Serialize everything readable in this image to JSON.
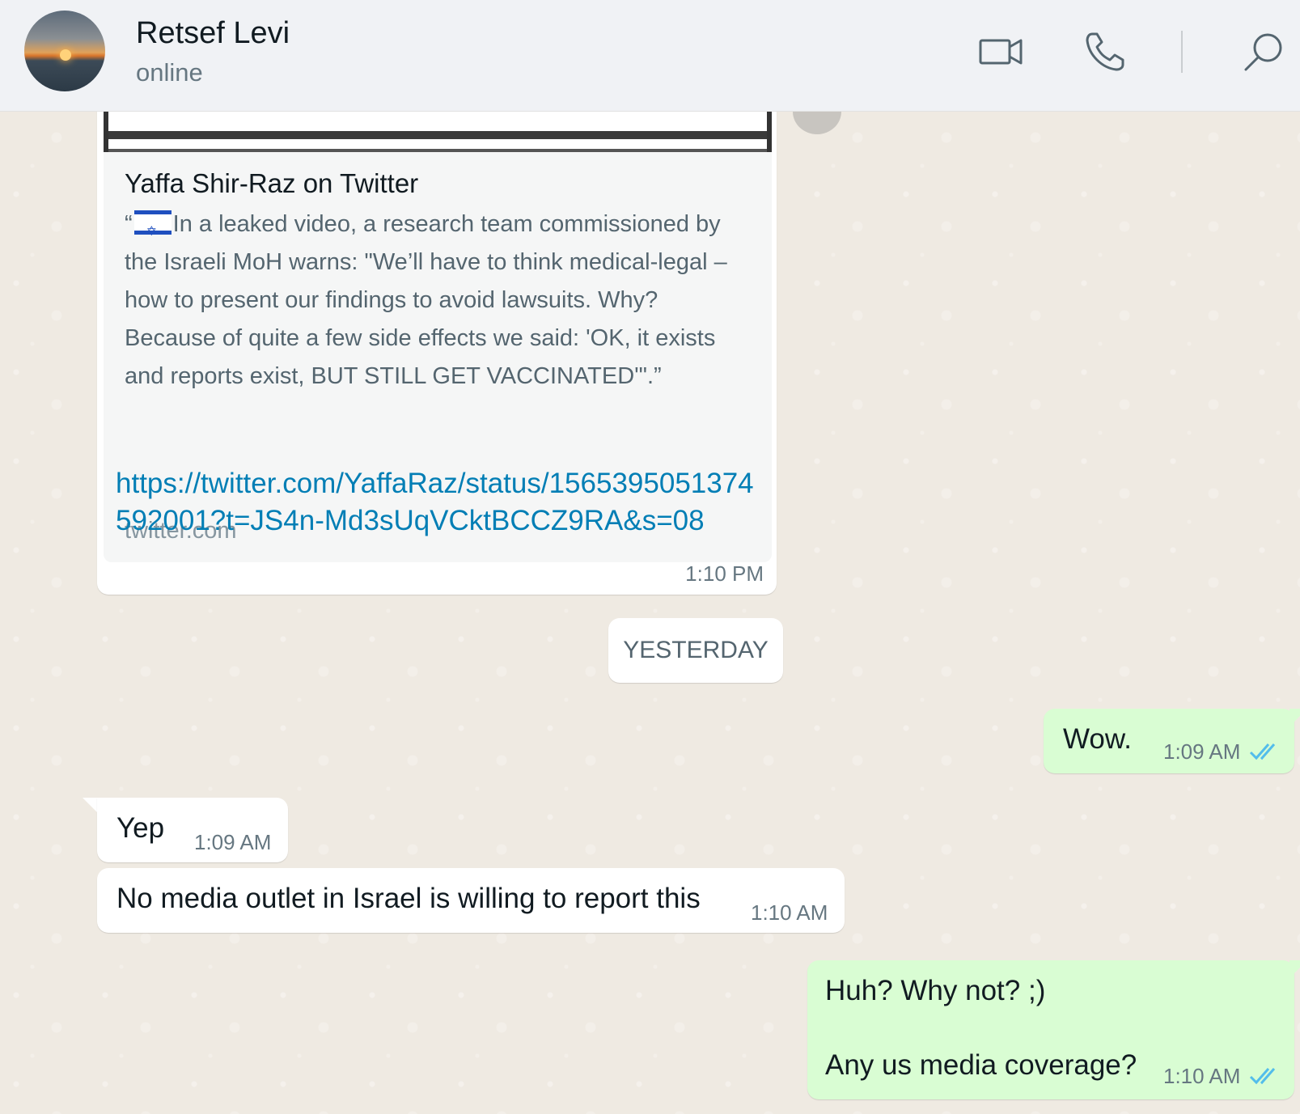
{
  "header": {
    "contact_name": "Retsef Levi",
    "status": "online",
    "icons": [
      "video-call-icon",
      "voice-call-icon",
      "search-icon"
    ]
  },
  "messages": {
    "link_preview": {
      "title": "Yaffa Shir-Raz on Twitter",
      "quote_open": "“",
      "description": "In a leaked video, a research team commissioned by the Israeli MoH warns: \"We’ll have to think medical-legal – how to present our findings to avoid lawsuits. Why? Because of quite a few side effects we said: 'OK, it exists and reports exist, BUT STILL GET VACCINATED'\".”",
      "domain": "twitter.com",
      "link": "https://twitter.com/YaffaRaz/status/1565395051374592001?t=JS4n-Md3sUqVCktBCCZ9RA&s=08",
      "time": "1:10 PM"
    },
    "day_divider": "YESTERDAY",
    "wow": {
      "text": "Wow.",
      "time": "1:09 AM"
    },
    "yep": {
      "text": "Yep",
      "time": "1:09 AM"
    },
    "no_media": {
      "text": "No media outlet in Israel is willing to report this",
      "time": "1:10 AM"
    },
    "huh": {
      "line1": "Huh? Why not? ;)",
      "line2": "Any us media coverage?",
      "time": "1:10 AM"
    }
  },
  "colors": {
    "outgoing_bubble": "#d9fdd3",
    "incoming_bubble": "#ffffff",
    "link": "#027eb5",
    "read_ticks": "#53bdeb",
    "chat_background": "#efeae2"
  }
}
